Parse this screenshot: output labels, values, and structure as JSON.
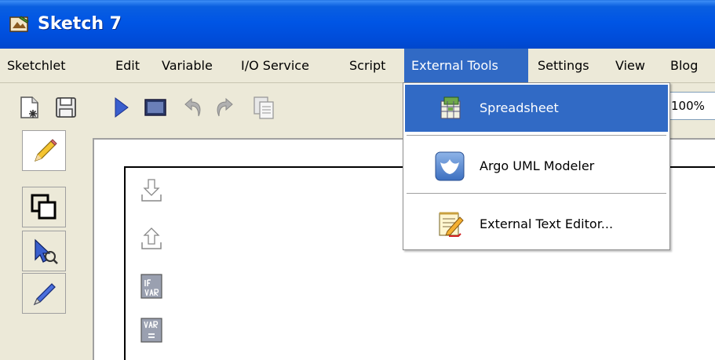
{
  "window": {
    "title": "Sketch 7"
  },
  "menubar": {
    "items": [
      {
        "label": "Sketchlet"
      },
      {
        "label": "Edit"
      },
      {
        "label": "Variable"
      },
      {
        "label": "I/O Service"
      },
      {
        "label": "Script"
      },
      {
        "label": "External Tools"
      },
      {
        "label": "Settings"
      },
      {
        "label": "View"
      },
      {
        "label": "Blog"
      }
    ]
  },
  "toolbar": {
    "zoom_value": "100%"
  },
  "dropdown": {
    "items": [
      {
        "label": "Spreadsheet",
        "icon": "spreadsheet-icon"
      },
      {
        "label": "Argo UML Modeler",
        "icon": "argo-uml-icon"
      },
      {
        "label": "External Text Editor...",
        "icon": "text-editor-icon"
      }
    ]
  },
  "colors": {
    "title_bar": "#0055E5",
    "highlight": "#316AC5",
    "menu_bg": "#ECE9D8"
  }
}
